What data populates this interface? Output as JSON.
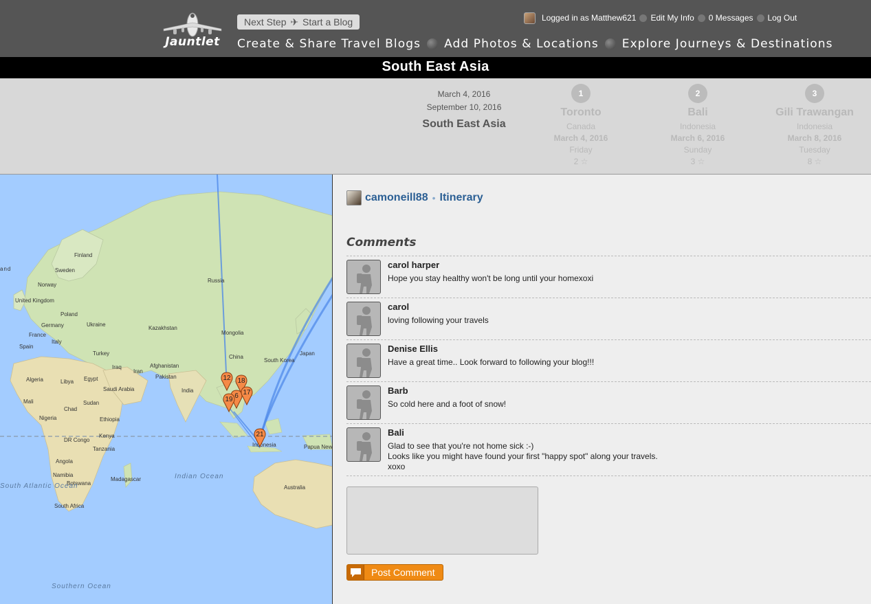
{
  "header": {
    "logo_text": "Jauntlet",
    "next_step": "Next Step",
    "next_step_action": "Start a Blog",
    "logged_in_text": "Logged in as Matthew621",
    "edit_info": "Edit My Info",
    "messages": "0 Messages",
    "logout": "Log Out",
    "nav": [
      "Create & Share Travel Blogs",
      "Add Photos & Locations",
      "Explore Journeys & Destinations"
    ]
  },
  "trip": {
    "title": "South East Asia",
    "start_date": "March 4, 2016",
    "end_date": "September 10, 2016",
    "name": "South East Asia",
    "stops": [
      {
        "num": "1",
        "city": "Toronto",
        "country": "Canada",
        "date": "March 4, 2016",
        "dow": "Friday",
        "count": "2"
      },
      {
        "num": "2",
        "city": "Bali",
        "country": "Indonesia",
        "date": "March 6, 2016",
        "dow": "Sunday",
        "count": "3"
      },
      {
        "num": "3",
        "city": "Gili Trawangan",
        "country": "Indonesia",
        "date": "March 8, 2016",
        "dow": "Tuesday",
        "count": "8"
      }
    ]
  },
  "map": {
    "labels": [
      "Finland",
      "Sweden",
      "Norway",
      "Russia",
      "United Kingdom",
      "Poland",
      "Ukraine",
      "Germany",
      "France",
      "Kazakhstan",
      "Mongolia",
      "Spain",
      "Italy",
      "Turkey",
      "Japan",
      "South Korea",
      "China",
      "Afghanistan",
      "Iraq",
      "Iran",
      "Pakistan",
      "Algeria",
      "Libya",
      "Egypt",
      "Saudi Arabia",
      "India",
      "Mali",
      "Chad",
      "Sudan",
      "Nigeria",
      "Ethiopia",
      "Kenya",
      "DR Congo",
      "Tanzania",
      "Angola",
      "Namibia",
      "Botswana",
      "Madagascar",
      "South Africa",
      "Indonesia",
      "Papua New Guinea",
      "Australia",
      "Indian Ocean",
      "Southern Ocean",
      "South Atlantic Ocean",
      "and"
    ],
    "markers": [
      "12",
      "18",
      "6",
      "17",
      "19",
      "21"
    ]
  },
  "panel": {
    "username": "camoneill88",
    "itinerary": "Itinerary",
    "comments_heading": "Comments",
    "comments": [
      {
        "name": "carol harper",
        "text": "Hope you stay healthy won't be long until your homexoxi"
      },
      {
        "name": "carol",
        "text": "loving following your travels"
      },
      {
        "name": "Denise Ellis",
        "text": "Have a great time.. Look forward to following your blog!!!"
      },
      {
        "name": "Barb",
        "text": "So cold here and a foot of snow!"
      },
      {
        "name": "Bali",
        "text": "Glad to see that you're not home sick :-)\nLooks like you might have found your first \"happy spot\" along your travels.\nxoxo"
      }
    ],
    "post_button": "Post Comment"
  }
}
